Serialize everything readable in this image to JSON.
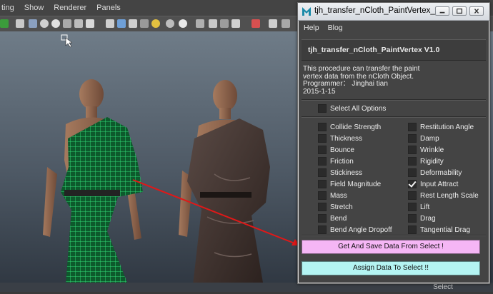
{
  "maya": {
    "menu": [
      "ting",
      "Show",
      "Renderer",
      "Panels"
    ],
    "bottom_select": "Select"
  },
  "window": {
    "title": "tjh_transfer_nCloth_PaintVertex_t...",
    "menu": {
      "help": "Help",
      "blog": "Blog"
    },
    "tool_title": "tjh_transfer_nCloth_PaintVertex V1.0",
    "info": {
      "line1": "This procedure can  transfer the paint",
      "line2": "vertex  data from the nCloth Object.",
      "line3": "Programmer： Jinghai tian",
      "line4": "2015-1-15"
    },
    "select_all": {
      "label": "Select All Options",
      "checked": false
    },
    "options_left": [
      {
        "label": "Collide Strength",
        "checked": false
      },
      {
        "label": "Thickness",
        "checked": false
      },
      {
        "label": "Bounce",
        "checked": false
      },
      {
        "label": "Friction",
        "checked": false
      },
      {
        "label": "Stickiness",
        "checked": false
      },
      {
        "label": "Field Magnitude",
        "checked": false
      },
      {
        "label": "Mass",
        "checked": false
      },
      {
        "label": "Stretch",
        "checked": false
      },
      {
        "label": "Bend",
        "checked": false
      },
      {
        "label": "Bend Angle Dropoff",
        "checked": false
      }
    ],
    "options_right": [
      {
        "label": "Restitution Angle",
        "checked": false
      },
      {
        "label": "Damp",
        "checked": false
      },
      {
        "label": "Wrinkle",
        "checked": false
      },
      {
        "label": "Rigidity",
        "checked": false
      },
      {
        "label": "Deformability",
        "checked": false
      },
      {
        "label": "Input Attract",
        "checked": true
      },
      {
        "label": "Rest Length Scale",
        "checked": false
      },
      {
        "label": "Lift",
        "checked": false
      },
      {
        "label": "Drag",
        "checked": false
      },
      {
        "label": "Tangential Drag",
        "checked": false
      }
    ],
    "buttons": {
      "get": "Get And Save Data From Select !",
      "assign": "Assign Data To Select !!"
    },
    "colors": {
      "get_button": "#f5b6f5",
      "assign_button": "#b4f4f2",
      "panel_bg": "#444444"
    }
  }
}
